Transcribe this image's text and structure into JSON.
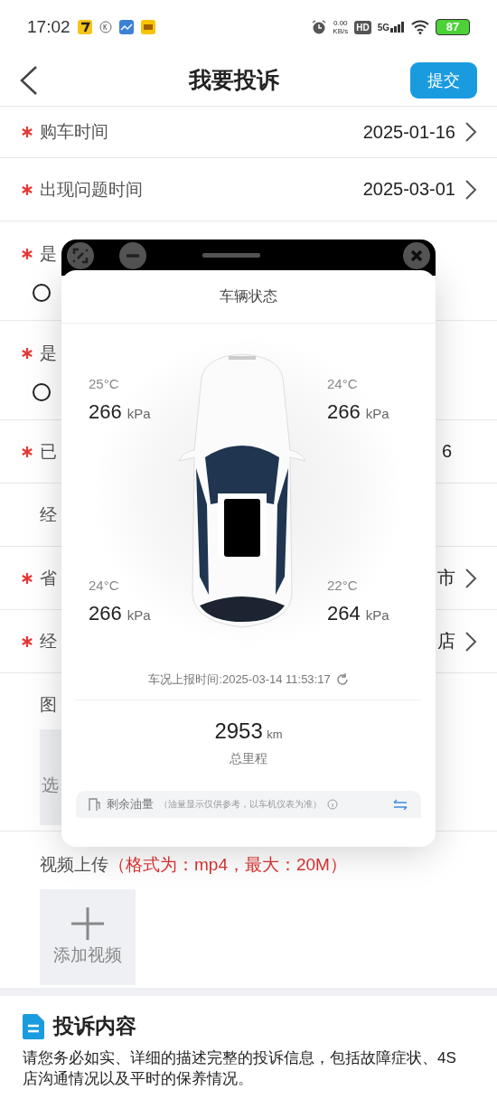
{
  "status_bar": {
    "time": "17:02",
    "speed_value": "0.00",
    "speed_unit": "KB/s",
    "hd": "HD",
    "network": "5G",
    "battery": "87"
  },
  "header": {
    "title": "我要投诉",
    "submit": "提交"
  },
  "form_rows": [
    {
      "kind": "select",
      "required": true,
      "label": "购车时间",
      "value": "2025-01-16"
    },
    {
      "kind": "select",
      "required": true,
      "label": "出现问题时间",
      "value": "2025-03-01"
    },
    {
      "kind": "radio",
      "required": true,
      "label": "是",
      "options": [
        {
          "selected": false
        }
      ]
    },
    {
      "kind": "radio",
      "required": true,
      "label": "是",
      "options": [
        {
          "selected": false
        }
      ]
    },
    {
      "kind": "text",
      "required": true,
      "label": "已",
      "value": "6"
    },
    {
      "kind": "text",
      "required": false,
      "label": "经"
    },
    {
      "kind": "select",
      "required": true,
      "label": "省",
      "value": "市"
    },
    {
      "kind": "select",
      "required": true,
      "label": "经",
      "value": "店"
    }
  ],
  "image_upload": {
    "label": "图",
    "button": "选"
  },
  "video_upload": {
    "label": "视频上传",
    "hint": "（格式为：mp4，最大：20M）",
    "button": "添加视频"
  },
  "complaint_content": {
    "title": "投诉内容",
    "description": "请您务必如实、详细的描述完整的投诉信息，包括故障症状、4S店沟通情况以及平时的保养情况。"
  },
  "vehicle_popup": {
    "title": "车辆状态",
    "tires": [
      {
        "temperature": "25°C",
        "pressure": "266",
        "unit": "kPa"
      },
      {
        "temperature": "24°C",
        "pressure": "266",
        "unit": "kPa"
      },
      {
        "temperature": "24°C",
        "pressure": "266",
        "unit": "kPa"
      },
      {
        "temperature": "22°C",
        "pressure": "264",
        "unit": "kPa"
      }
    ],
    "report_time": "车况上报时间:2025-03-14 11:53:17",
    "mileage": "2953",
    "mileage_unit": "km",
    "mileage_label": "总里程",
    "fuel_label": "剩余油量",
    "fuel_note": "（油量显示仅供参考，以车机仪表为准）"
  }
}
